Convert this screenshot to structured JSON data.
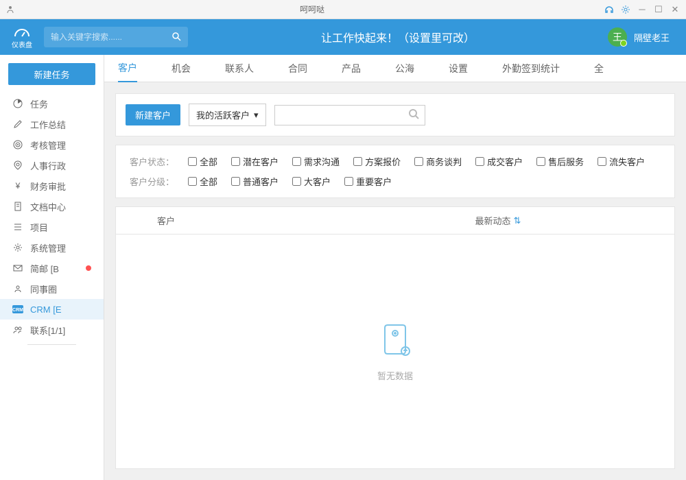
{
  "titlebar": {
    "title": "呵呵哒"
  },
  "header": {
    "dash_label": "仪表盘",
    "search_placeholder": "输入关键字搜索......",
    "title": "让工作快起来！（设置里可改）",
    "avatar_char": "王",
    "username": "隔壁老王"
  },
  "sidebar": {
    "new_task": "新建任务",
    "items": [
      {
        "icon": "pie",
        "label": "任务"
      },
      {
        "icon": "pencil",
        "label": "工作总结"
      },
      {
        "icon": "target",
        "label": "考核管理"
      },
      {
        "icon": "pin",
        "label": "人事行政"
      },
      {
        "icon": "yen",
        "label": "财务审批"
      },
      {
        "icon": "doc",
        "label": "文档中心"
      },
      {
        "icon": "list",
        "label": "项目"
      },
      {
        "icon": "gear",
        "label": "系统管理"
      },
      {
        "icon": "mail",
        "label": "简邮 [B",
        "dot": true
      },
      {
        "icon": "group",
        "label": "同事圈"
      },
      {
        "icon": "crm",
        "label": "CRM [E",
        "active": true
      },
      {
        "icon": "people",
        "label": "联系[1/1]"
      }
    ]
  },
  "tabs": [
    "客户",
    "机会",
    "联系人",
    "合同",
    "产品",
    "公海",
    "设置",
    "外勤签到统计",
    "全"
  ],
  "toolbar": {
    "new_customer": "新建客户",
    "dropdown": "我的活跃客户"
  },
  "filters": {
    "status_label": "客户状态：",
    "status_opts": [
      "全部",
      "潜在客户",
      "需求沟通",
      "方案报价",
      "商务谈判",
      "成交客户",
      "售后服务",
      "流失客户"
    ],
    "level_label": "客户分级：",
    "level_opts": [
      "全部",
      "普通客户",
      "大客户",
      "重要客户"
    ]
  },
  "data_table": {
    "col1": "客户",
    "col2": "最新动态",
    "empty": "暂无数据"
  }
}
